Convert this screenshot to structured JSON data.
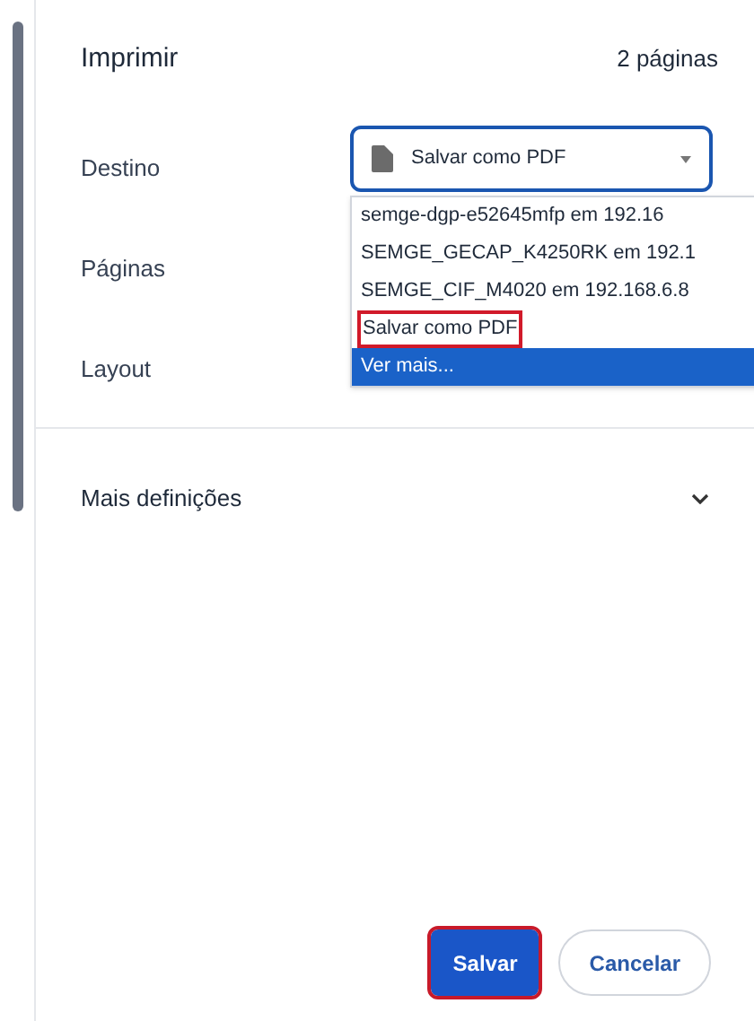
{
  "title": "Imprimir",
  "page_count": "2 páginas",
  "settings": [
    {
      "label": "Destino"
    },
    {
      "label": "Páginas"
    },
    {
      "label": "Layout"
    }
  ],
  "destination": {
    "value": "Salvar como PDF",
    "expanded": true,
    "options": [
      {
        "label": "semge-dgp-e52645mfp em 192.16",
        "hovered": false,
        "highlighted": false
      },
      {
        "label": "SEMGE_GECAP_K4250RK em 192.1",
        "hovered": false,
        "highlighted": false
      },
      {
        "label": "SEMGE_CIF_M4020 em 192.168.6.8",
        "hovered": false,
        "highlighted": false
      },
      {
        "label": "Salvar como PDF",
        "hovered": false,
        "highlighted": true
      },
      {
        "label": "Ver mais...",
        "hovered": true,
        "highlighted": false
      }
    ]
  },
  "more_settings": {
    "label": "Mais definições",
    "expanded": false
  },
  "buttons": [
    {
      "label": "Salvar",
      "kind": "primary",
      "highlighted": true
    },
    {
      "label": "Cancelar",
      "kind": "secondary",
      "highlighted": false
    }
  ]
}
